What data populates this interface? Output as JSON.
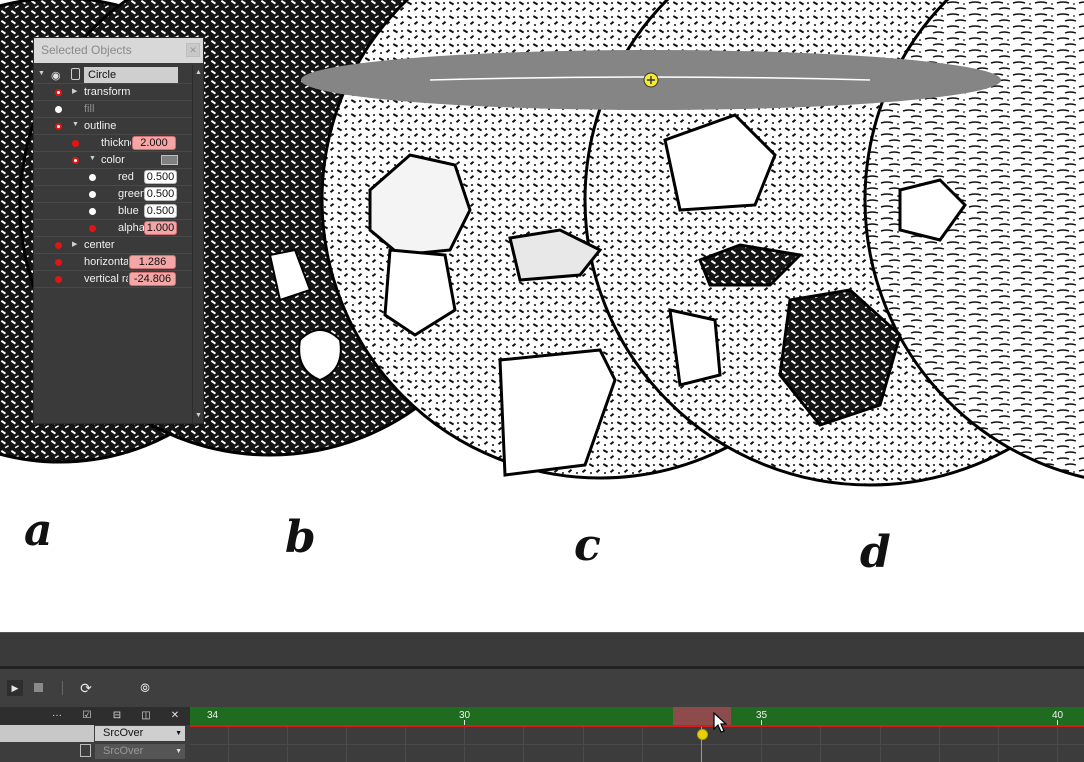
{
  "canvas": {
    "plate_letters": [
      "a",
      "b",
      "c",
      "d"
    ],
    "selection_handle_icon": "plus-circle-icon"
  },
  "selected_objects_panel": {
    "title": "Selected Objects",
    "close_icon": "close-icon",
    "object_name": "Circle",
    "rows": [
      {
        "label": "transform"
      },
      {
        "label": "fill"
      },
      {
        "label": "outline"
      },
      {
        "label": "thickness",
        "value": "2.000"
      },
      {
        "label": "color"
      },
      {
        "label": "red",
        "value": "0.500"
      },
      {
        "label": "green",
        "value": "0.500"
      },
      {
        "label": "blue",
        "value": "0.500"
      },
      {
        "label": "alpha",
        "value": "1.000"
      },
      {
        "label": "center"
      },
      {
        "label": "horizontal radius",
        "value": "1.286"
      },
      {
        "label": "vertical radius",
        "value": "-24.806"
      }
    ],
    "outline_color": "#808080",
    "animated_value_color": "#f4a6a6"
  },
  "timeline": {
    "toolbar_icons": [
      "play-icon",
      "stop-icon",
      "loop-icon",
      "onion-skin-icon"
    ],
    "header_icons": [
      "more-icon",
      "edit-icon",
      "collapse-icon",
      "columns-icon",
      "close-icon"
    ],
    "layers": [
      {
        "blend_mode": "SrcOver",
        "active": true
      },
      {
        "blend_mode": "SrcOver",
        "active": false
      }
    ],
    "ruler_labels": [
      "34",
      "30",
      "35",
      "40"
    ],
    "ruler_color": "#1f6b1f",
    "current_range_color": "#8e4b4b",
    "playhead_color": "#e8d300"
  }
}
